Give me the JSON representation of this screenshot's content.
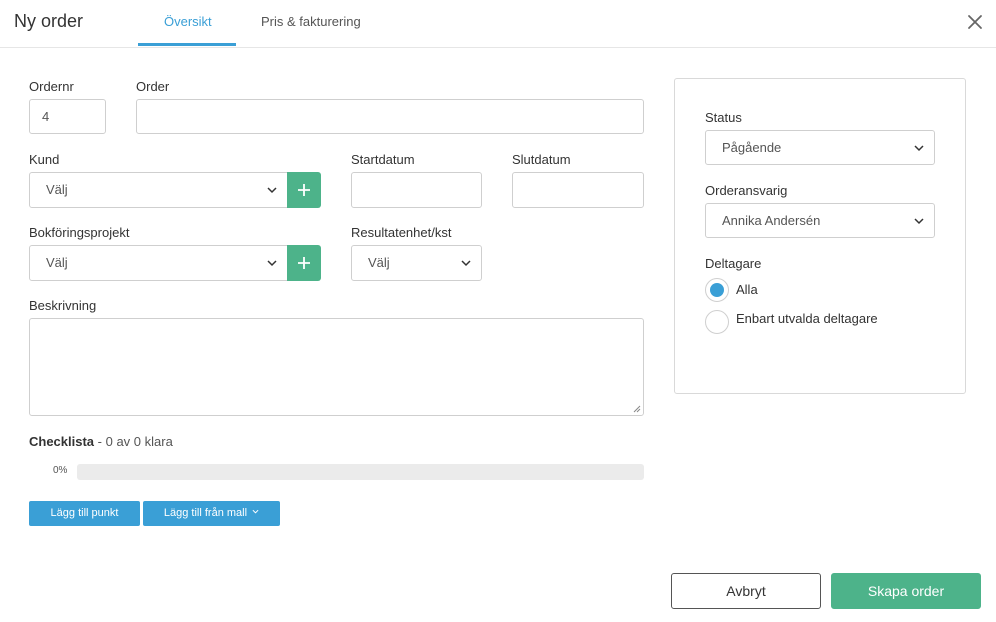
{
  "header": {
    "title": "Ny order",
    "tabs": [
      {
        "label": "Översikt",
        "active": true
      },
      {
        "label": "Pris & fakturering",
        "active": false
      }
    ]
  },
  "form": {
    "ordernr": {
      "label": "Ordernr",
      "value": "4"
    },
    "order": {
      "label": "Order",
      "value": ""
    },
    "kund": {
      "label": "Kund",
      "value": "Välj"
    },
    "startdatum": {
      "label": "Startdatum",
      "value": ""
    },
    "slutdatum": {
      "label": "Slutdatum",
      "value": ""
    },
    "bokforingsprojekt": {
      "label": "Bokföringsprojekt",
      "value": "Välj"
    },
    "resultatenhet": {
      "label": "Resultatenhet/kst",
      "value": "Välj"
    },
    "beskrivning": {
      "label": "Beskrivning",
      "value": ""
    }
  },
  "checklist": {
    "title": "Checklista",
    "summary": " - 0 av 0 klara",
    "percent_label": "0%",
    "progress": 0,
    "add_item_label": "Lägg till punkt",
    "add_from_template_label": "Lägg till från mall"
  },
  "side": {
    "status": {
      "label": "Status",
      "value": "Pågående"
    },
    "ansvarig": {
      "label": "Orderansvarig",
      "value": "Annika Andersén"
    },
    "deltagare": {
      "label": "Deltagare",
      "options": [
        {
          "label": "Alla",
          "selected": true
        },
        {
          "label": "Enbart utvalda deltagare",
          "selected": false
        }
      ]
    }
  },
  "footer": {
    "cancel_label": "Avbryt",
    "create_label": "Skapa order"
  },
  "colors": {
    "accent": "#3a9fd6",
    "primary_green": "#4db38a"
  }
}
